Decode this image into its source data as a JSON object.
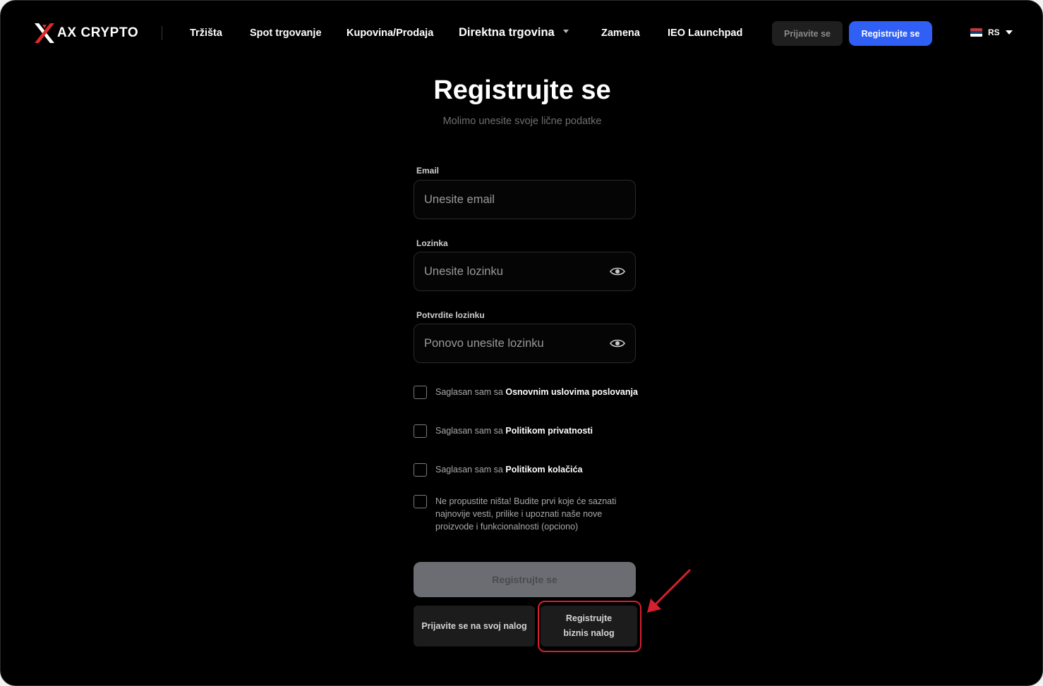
{
  "header": {
    "brand": "AX CRYPTO",
    "nav": [
      {
        "label": "Tržišta"
      },
      {
        "label": "Spot trgovanje"
      },
      {
        "label": "Kupovina/Prodaja"
      },
      {
        "label": "Direktna trgovina"
      },
      {
        "label": "Zamena"
      },
      {
        "label": "IEO Launchpad"
      }
    ],
    "login_label": "Prijavite se",
    "register_label": "Registrujte se",
    "language": "RS"
  },
  "form": {
    "title": "Registrujte se",
    "subtitle": "Molimo unesite svoje lične podatke",
    "email": {
      "label": "Email",
      "placeholder": "Unesite email"
    },
    "password": {
      "label": "Lozinka",
      "placeholder": "Unesite lozinku"
    },
    "confirm": {
      "label": "Potvrdite lozinku",
      "placeholder": "Ponovo unesite lozinku"
    },
    "checks": [
      {
        "prefix": "Saglasan sam sa ",
        "link": "Osnovnim uslovima poslovanja"
      },
      {
        "prefix": "Saglasan sam sa ",
        "link": "Politikom privatnosti"
      },
      {
        "prefix": "Saglasan sam sa ",
        "link": "Politikom kolačića"
      },
      {
        "prefix": "Ne propustite ništa! Budite prvi koje će saznati najnovije vesti, prilike i upoznati naše nove proizvode i funkcionalnosti (opciono)",
        "link": ""
      }
    ],
    "submit_label": "Registrujte se",
    "signin_label": "Prijavite se na svoj nalog",
    "business_label_line1": "Registrujte",
    "business_label_line2": "biznis nalog"
  },
  "colors": {
    "accent": "#2f5ff5",
    "annotation": "#d6202f",
    "background": "#000000"
  },
  "icons": [
    "ax-logo-icon",
    "chevron-down-icon",
    "serbia-flag-icon",
    "eye-icon",
    "annotation-arrow-icon"
  ]
}
